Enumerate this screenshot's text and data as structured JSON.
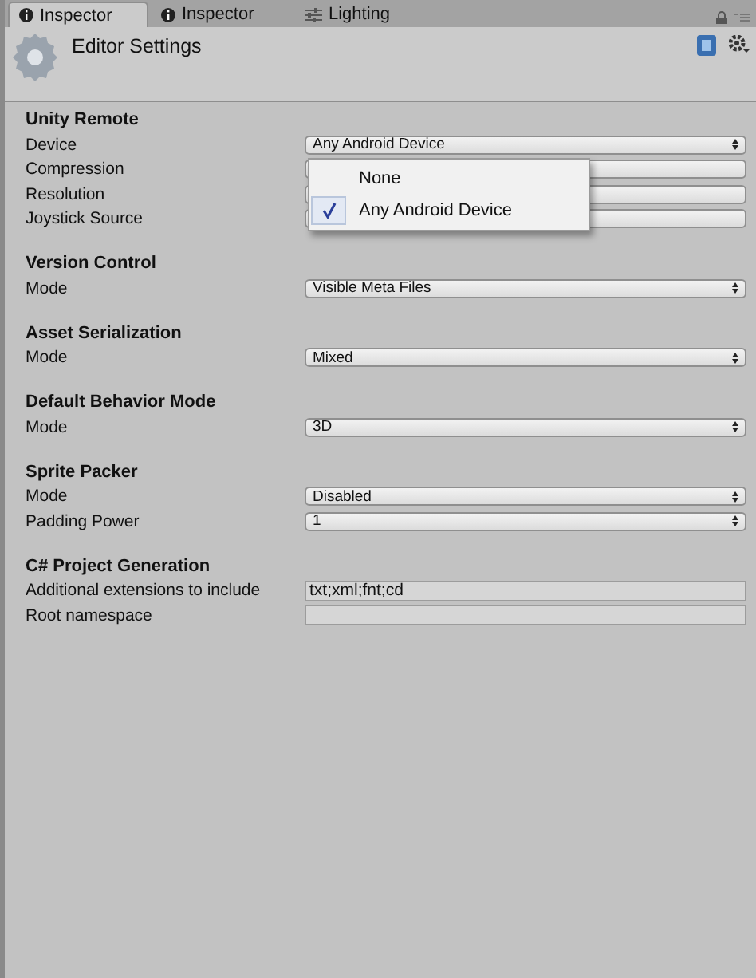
{
  "tabs": [
    {
      "label": "Inspector",
      "selected": true
    },
    {
      "label": "Inspector",
      "selected": false
    },
    {
      "label": "Lighting",
      "selected": false
    }
  ],
  "header": {
    "title": "Editor Settings"
  },
  "sections": [
    {
      "title": "Unity Remote",
      "rows": [
        {
          "label": "Device",
          "kind": "dropdown",
          "value": "Any Android Device"
        },
        {
          "label": "Compression",
          "kind": "dropdown"
        },
        {
          "label": "Resolution",
          "kind": "dropdown"
        },
        {
          "label": "Joystick Source",
          "kind": "dropdown"
        }
      ]
    },
    {
      "title": "Version Control",
      "rows": [
        {
          "label": "Mode",
          "kind": "dropdown",
          "value": "Visible Meta Files"
        }
      ]
    },
    {
      "title": "Asset Serialization",
      "rows": [
        {
          "label": "Mode",
          "kind": "dropdown",
          "value": "Mixed"
        }
      ]
    },
    {
      "title": "Default Behavior Mode",
      "rows": [
        {
          "label": "Mode",
          "kind": "dropdown",
          "value": "3D"
        }
      ]
    },
    {
      "title": "Sprite Packer",
      "rows": [
        {
          "label": "Mode",
          "kind": "dropdown",
          "value": "Disabled"
        },
        {
          "label": "Padding Power",
          "kind": "dropdown",
          "value": "1"
        }
      ]
    },
    {
      "title": "C# Project Generation",
      "rows": [
        {
          "label": "Additional extensions to include",
          "kind": "text",
          "value": "txt;xml;fnt;cd"
        },
        {
          "label": "Root namespace",
          "kind": "text"
        }
      ]
    }
  ],
  "popup": {
    "items": [
      {
        "label": "None",
        "selected": false
      },
      {
        "label": "Any Android Device",
        "selected": true
      }
    ]
  }
}
